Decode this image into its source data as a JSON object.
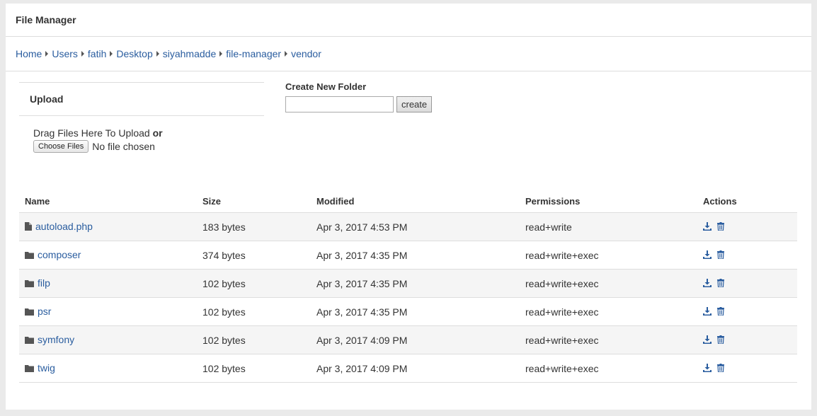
{
  "header": {
    "title": "File Manager"
  },
  "breadcrumb": [
    "Home",
    "Users",
    "fatih",
    "Desktop",
    "siyahmadde",
    "file-manager",
    "vendor"
  ],
  "upload": {
    "title": "Upload",
    "drag_text": "Drag Files Here To Upload",
    "or_text": "or",
    "choose_label": "Choose Files",
    "no_file_text": "No file chosen"
  },
  "new_folder": {
    "label": "Create New Folder",
    "input_value": "",
    "create_label": "create"
  },
  "table": {
    "headers": [
      "Name",
      "Size",
      "Modified",
      "Permissions",
      "Actions"
    ],
    "rows": [
      {
        "icon": "file-icon",
        "name": "autoload.php",
        "size": "183 bytes",
        "modified": "Apr 3, 2017 4:53 PM",
        "permissions": "read+write"
      },
      {
        "icon": "folder-icon",
        "name": "composer",
        "size": "374 bytes",
        "modified": "Apr 3, 2017 4:35 PM",
        "permissions": "read+write+exec"
      },
      {
        "icon": "folder-icon",
        "name": "filp",
        "size": "102 bytes",
        "modified": "Apr 3, 2017 4:35 PM",
        "permissions": "read+write+exec"
      },
      {
        "icon": "folder-icon",
        "name": "psr",
        "size": "102 bytes",
        "modified": "Apr 3, 2017 4:35 PM",
        "permissions": "read+write+exec"
      },
      {
        "icon": "folder-icon",
        "name": "symfony",
        "size": "102 bytes",
        "modified": "Apr 3, 2017 4:09 PM",
        "permissions": "read+write+exec"
      },
      {
        "icon": "folder-icon",
        "name": "twig",
        "size": "102 bytes",
        "modified": "Apr 3, 2017 4:09 PM",
        "permissions": "read+write+exec"
      }
    ]
  },
  "colors": {
    "link": "#2a5d9f",
    "action_icon": "#2a5d9f"
  }
}
